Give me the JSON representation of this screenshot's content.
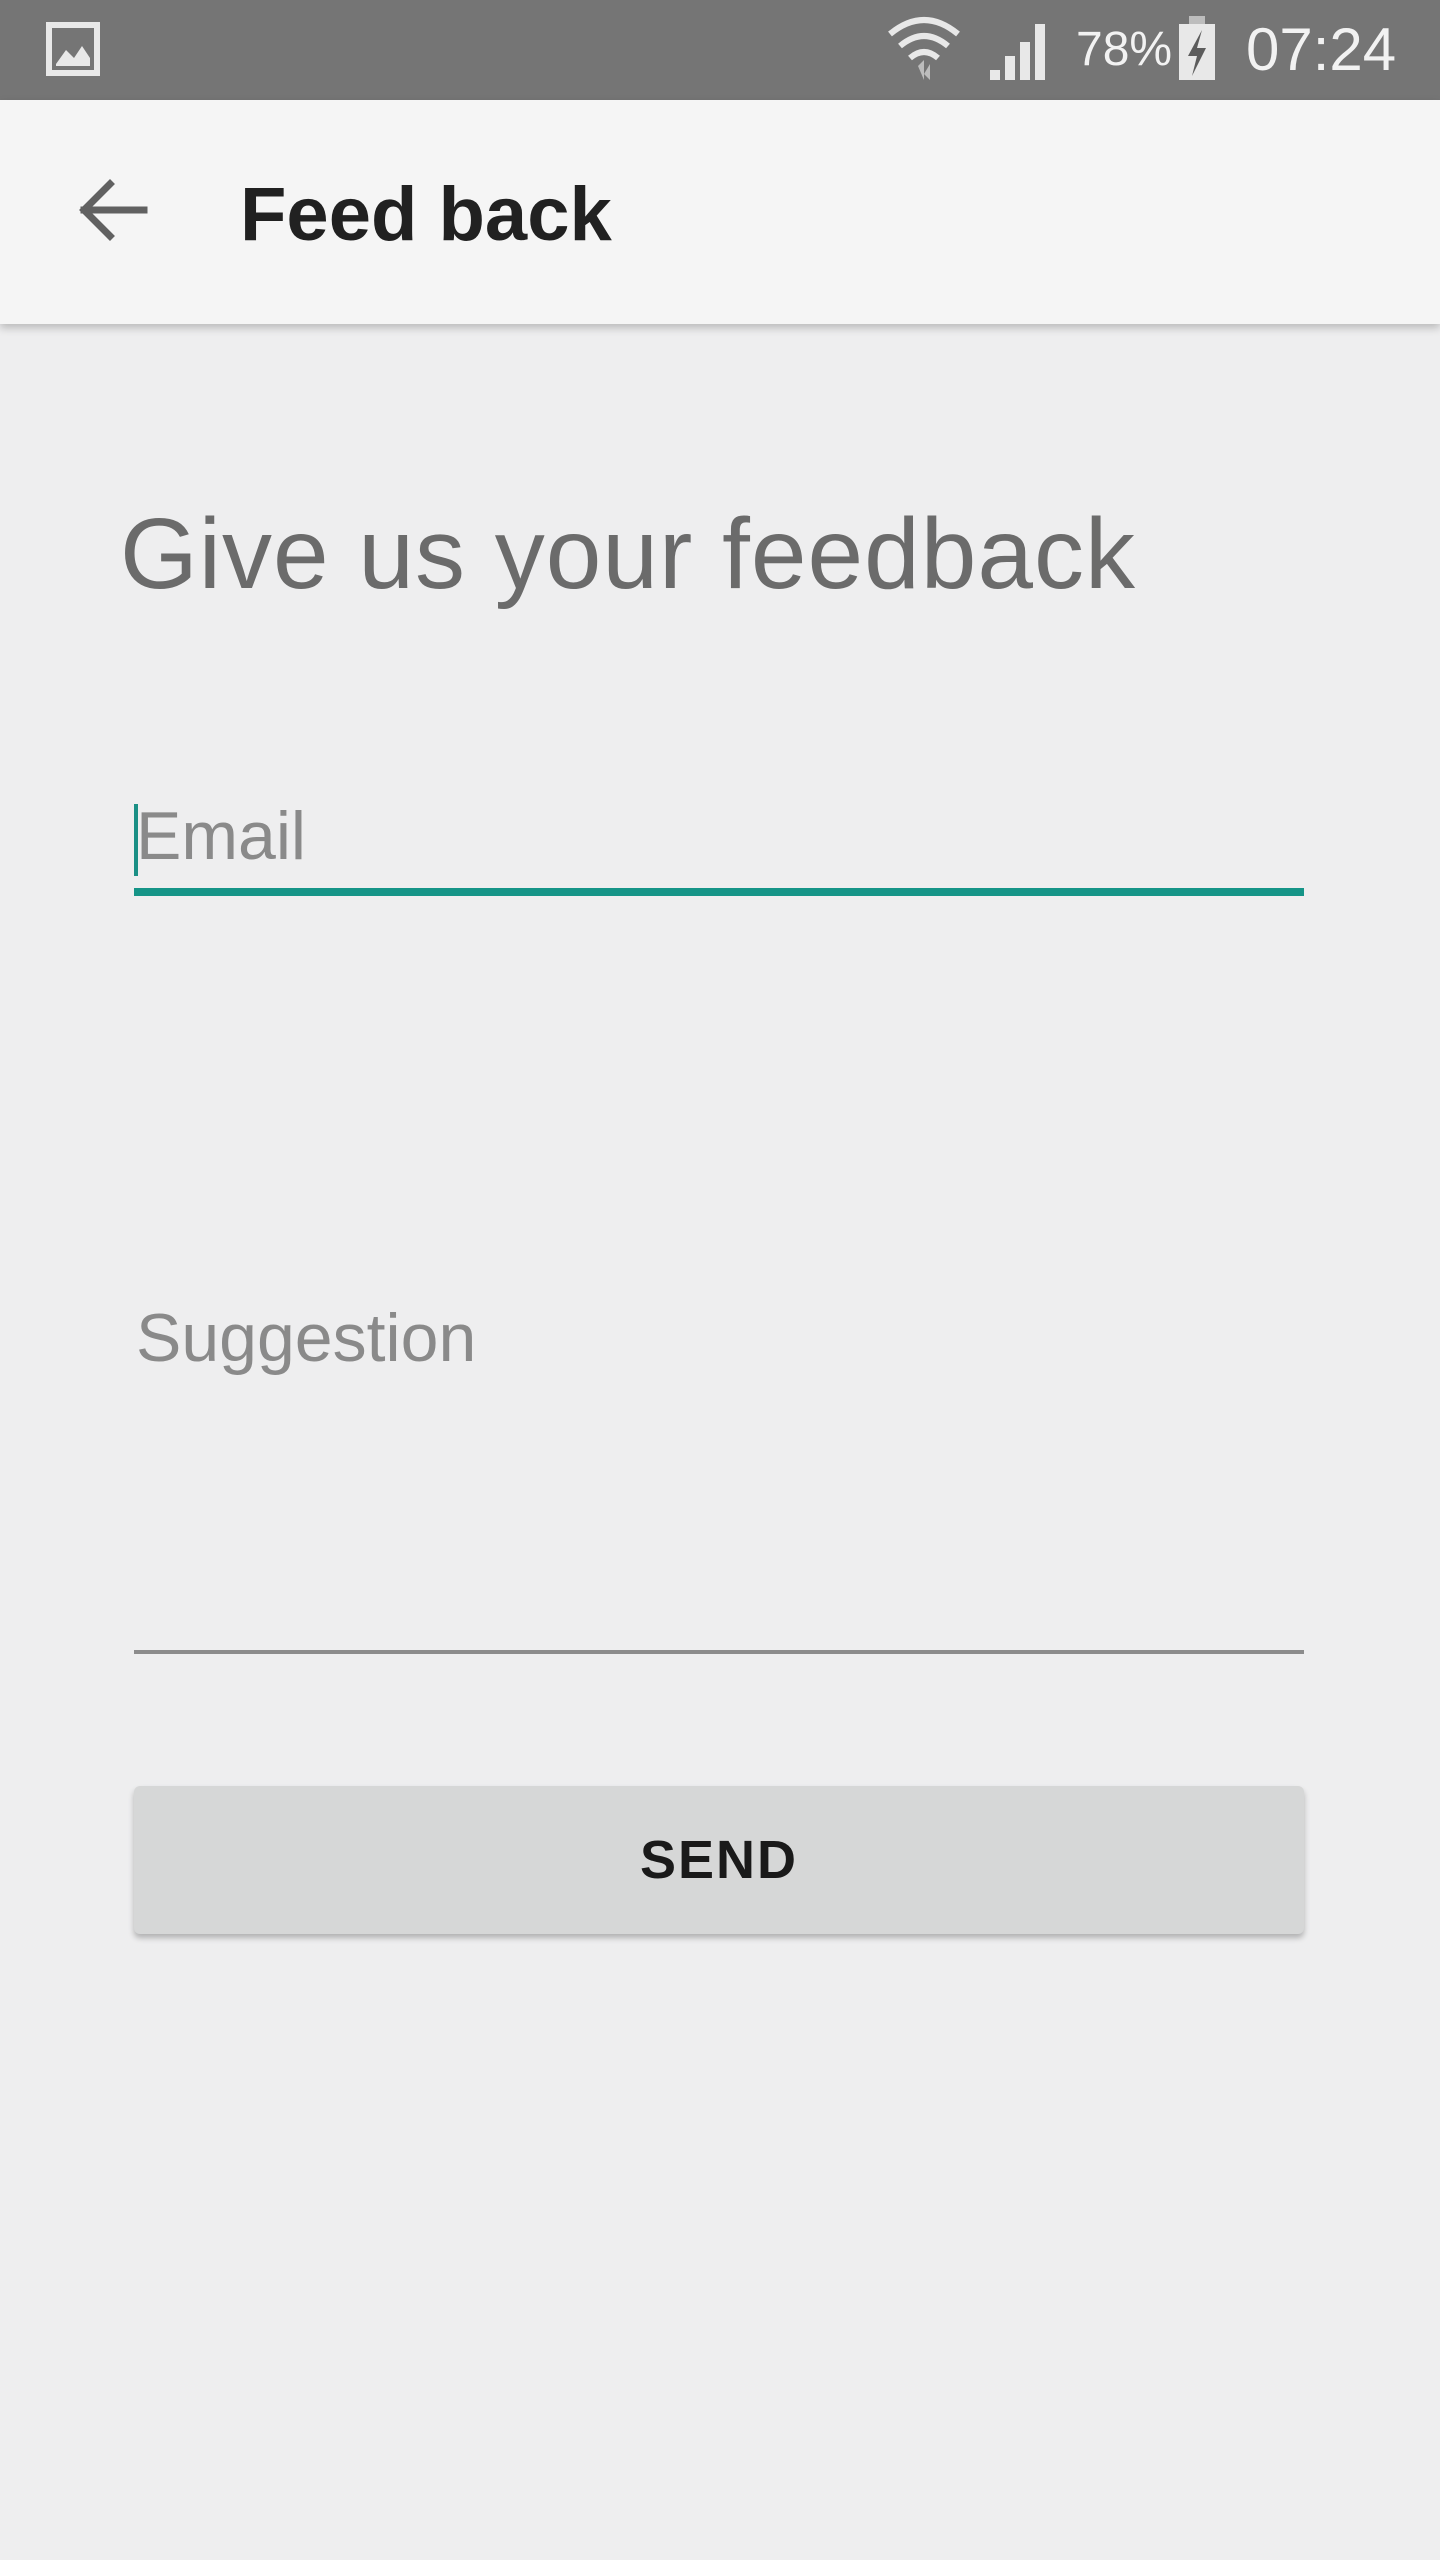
{
  "status_bar": {
    "notification_icon": "image-icon",
    "wifi_icon": "wifi-icon",
    "signal_icon": "cell-signal-icon",
    "battery_percent": "78%",
    "battery_icon": "battery-charging-icon",
    "time": "07:24"
  },
  "app_bar": {
    "back_icon": "arrow-back-icon",
    "title": "Feed back"
  },
  "main": {
    "heading": "Give us your feedback",
    "email": {
      "placeholder": "Email",
      "value": ""
    },
    "suggestion": {
      "placeholder": "Suggestion",
      "value": ""
    },
    "send_label": "SEND"
  },
  "colors": {
    "status_bar": "#757575",
    "app_bar": "#f5f5f5",
    "background": "#eeeeef",
    "accent": "#159487",
    "button": "#d6d7d7"
  }
}
